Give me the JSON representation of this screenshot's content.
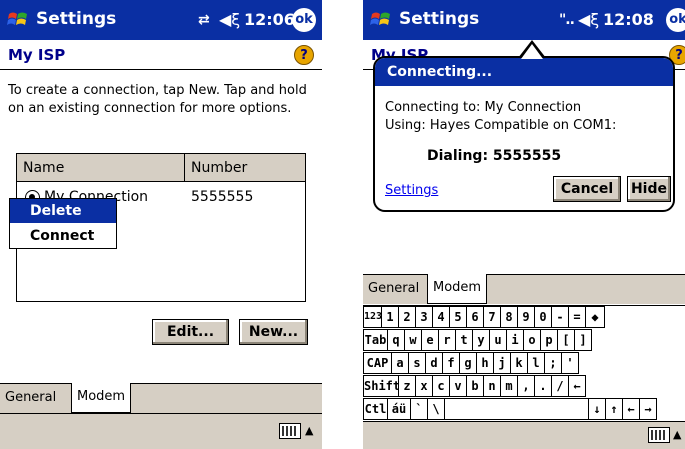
{
  "left": {
    "titlebar": {
      "title": "Settings",
      "time": "12:06",
      "ok": "ok"
    },
    "page_title": "My ISP",
    "help": "?",
    "intro": "To create a connection, tap New. Tap and hold on an existing connection for more options.",
    "list": {
      "columns": [
        "Name",
        "Number"
      ],
      "rows": [
        {
          "name": "My Connection",
          "number": "5555555"
        }
      ]
    },
    "context_menu": {
      "items": [
        "Delete",
        "Connect"
      ]
    },
    "buttons": {
      "edit": "Edit...",
      "new": "New..."
    },
    "tabs": [
      "General",
      "Modem"
    ]
  },
  "right": {
    "titlebar": {
      "title": "Settings",
      "time": "12:08",
      "ok": "ok"
    },
    "page_title": "My ISP",
    "dialog": {
      "title": "Connecting...",
      "line1": "Connecting to: My Connection",
      "line2": "Using: Hayes Compatible on COM1:",
      "status": "Dialing: 5555555",
      "link": "Settings",
      "cancel": "Cancel",
      "hide": "Hide"
    },
    "tabs": [
      "General",
      "Modem"
    ],
    "keyboard": {
      "rows": [
        [
          "123",
          "1",
          "2",
          "3",
          "4",
          "5",
          "6",
          "7",
          "8",
          "9",
          "0",
          "-",
          "=",
          "◆"
        ],
        [
          "Tab",
          "q",
          "w",
          "e",
          "r",
          "t",
          "y",
          "u",
          "i",
          "o",
          "p",
          "[",
          "]"
        ],
        [
          "CAP",
          "a",
          "s",
          "d",
          "f",
          "g",
          "h",
          "j",
          "k",
          "l",
          ";",
          "'"
        ],
        [
          "Shift",
          "z",
          "x",
          "c",
          "v",
          "b",
          "n",
          "m",
          ",",
          ".",
          "/",
          "←"
        ],
        [
          "Ctl",
          "áü",
          "`",
          "\\",
          "",
          "↓",
          "↑",
          "←",
          "→"
        ]
      ]
    }
  },
  "icons": {
    "start": "windows-flag-icon",
    "connectivity": "connectivity-icon",
    "volume": "speaker-icon",
    "help": "help-icon",
    "keyboard": "keyboard-icon"
  },
  "colors": {
    "titlebar": "#0a2fa3",
    "chrome": "#d6cfc4",
    "help": "#e8a500",
    "link": "#0000ee"
  }
}
